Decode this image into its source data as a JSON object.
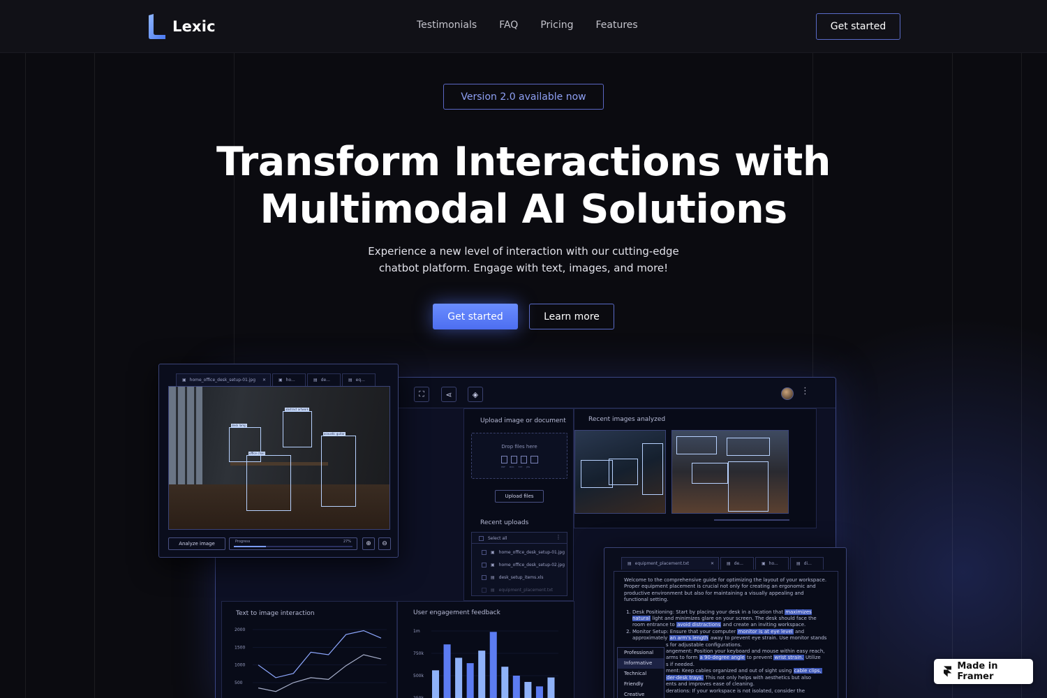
{
  "nav": {
    "logo_text": "Lexic",
    "links": [
      "Testimonials",
      "FAQ",
      "Pricing",
      "Features"
    ],
    "cta": "Get started"
  },
  "hero": {
    "badge": "Version 2.0 available now",
    "title_line1": "Transform Interactions with",
    "title_line2": "Multimodal AI Solutions",
    "subtitle_line1": "Experience a new level of interaction with our cutting-edge",
    "subtitle_line2": "chatbot platform. Engage with text, images, and more!",
    "primary_button": "Get started",
    "secondary_button": "Learn more"
  },
  "colors": {
    "accent": "#5b7cfa",
    "background": "#0b0b10",
    "badge_text": "#8fa0f4"
  },
  "image_window": {
    "tabs": [
      "home_office_desk_setup-01.jpg",
      "ho...",
      "de...",
      "eq..."
    ],
    "detections": [
      "desk lamp",
      "abstract artwork",
      "office chair",
      "acoustic guitar"
    ],
    "analyze_button": "Analyze image",
    "progress_label": "Progress",
    "progress_value": "27%",
    "progress_fraction": 0.27
  },
  "app": {
    "upload_title": "Upload image or document",
    "drop_text": "Drop files here",
    "file_types": [
      "PDF",
      "DOC",
      "TXT",
      "JPG"
    ],
    "upload_button": "Upload files",
    "recent_uploads_title": "Recent uploads",
    "select_all": "Select all",
    "files": [
      "home_office_desk_setup-01.jpg",
      "home_office_desk_setup-02.jpg",
      "desk_setup_items.xls",
      "equipment_placement.txt"
    ],
    "recent_images_title": "Recent images analyzed",
    "chart1_title": "Text to image interaction",
    "chart2_title": "User engagement feedback"
  },
  "chart_data": [
    {
      "type": "line",
      "title": "Text to image interaction",
      "yticks": [
        "2000",
        "1500",
        "1000",
        "500"
      ],
      "ylim": [
        500,
        2000
      ],
      "series": [
        {
          "values": [
            1000,
            640,
            760,
            1360,
            1290,
            1860,
            1970,
            1760
          ]
        },
        {
          "values": [
            350,
            250,
            500,
            640,
            590,
            980,
            1290,
            1170
          ]
        }
      ]
    },
    {
      "type": "bar",
      "title": "User engagement feedback",
      "yticks": [
        "1m",
        "750k",
        "500k",
        "250k"
      ],
      "ylim": [
        0,
        1000000
      ],
      "values": [
        560000,
        850000,
        700000,
        640000,
        780000,
        990000,
        600000,
        500000,
        430000,
        380000,
        480000
      ]
    }
  ],
  "doc_window": {
    "tabs": [
      "equipment_placement.txt",
      "de...",
      "ho...",
      "di..."
    ],
    "intro": "Welcome to the comprehensive guide for optimizing the layout of your workspace. Proper equipment placement is crucial not only for creating an ergonomic and productive environment but also for maintaining a visually appealing and functional setting.",
    "item1_a": "Desk Positioning: Start by placing your desk in a location that ",
    "item1_hl": "maximizes natural",
    "item1_b": " light and minimizes glare on your screen. The desk should face the room entrance to ",
    "item1_hl2": "avoid distractions",
    "item1_c": " and create an inviting workspace.",
    "item2_a": "Monitor Setup: Ensure that your computer ",
    "item2_hl": "monitor is at eye level",
    "item2_b": " and approximately ",
    "item2_hl2": "an arm's length",
    "item2_c": " away to prevent eye strain. Use monitor stands",
    "item3_a": "s for adjustable configurations.",
    "item3_b": "angement: Position your keyboard and mouse within easy reach,",
    "item3_c": "arms to form ",
    "item3_hl": "a 90-degree angle",
    "item3_d": " to prevent ",
    "item3_hl2": "wrist strain.",
    "item3_e": " Utilize",
    "item3_f": "s if needed.",
    "item4_a": "ment: Keep cables organized and out of sight using ",
    "item4_hl": "cable clips,",
    "item4_b": "der-desk trays.",
    "item4_c": " This not only helps with aesthetics but also",
    "item4_d": "ents and improves ease of cleaning.",
    "item5_a": "derations: If your workspace is not isolated, consider the",
    "tone_menu": [
      "Professional",
      "Informative",
      "Technical",
      "Friendly",
      "Creative"
    ]
  },
  "framer_badge": "Made in Framer"
}
